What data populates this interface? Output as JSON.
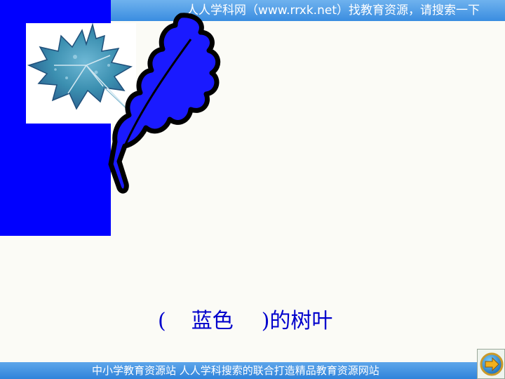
{
  "header": {
    "site_text": "人人学科网（www.rrxk.net）找教育资源，请搜索一下"
  },
  "slide": {
    "caption_open": "(",
    "caption_answer": "蓝色",
    "caption_rest": ")的树叶"
  },
  "footer": {
    "site_text": "中小学教育资源站 人人学科搜索的联合打造精品教育资源网站"
  },
  "colors": {
    "accent_blue": "#0000ff",
    "banner_blue": "#3a8de0",
    "caption_blue": "#0000cc",
    "leaf_photo_teal": "#3b8fb0"
  },
  "icons": {
    "leaf_outline": "leaf-outline-icon",
    "leaf_photo": "leaf-photo-icon",
    "next_arrow": "next-arrow-icon"
  }
}
